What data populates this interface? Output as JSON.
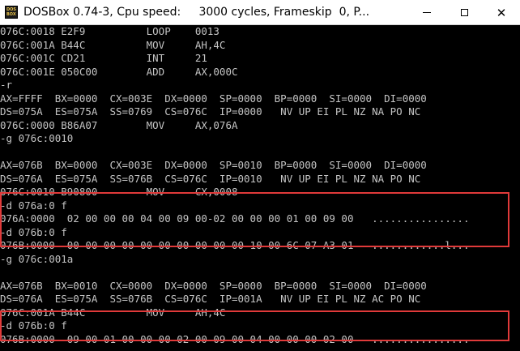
{
  "window": {
    "title": "DOSBox 0.74-3, Cpu speed:     3000 cycles, Frameskip  0, P...",
    "icon_label_top": "DOS",
    "icon_label_bottom": "BOX",
    "icon": "dosbox-icon",
    "buttons": [
      "minimize-icon",
      "maximize-icon",
      "close-icon"
    ],
    "close_glyph": "✕"
  },
  "console": {
    "lines": [
      "076C:0018 E2F9          LOOP    0013",
      "076C:001A B44C          MOV     AH,4C",
      "076C:001C CD21          INT     21",
      "076C:001E 050C00        ADD     AX,000C",
      "-r",
      "AX=FFFF  BX=0000  CX=003E  DX=0000  SP=0000  BP=0000  SI=0000  DI=0000",
      "DS=075A  ES=075A  SS=0769  CS=076C  IP=0000   NV UP EI PL NZ NA PO NC",
      "076C:0000 B86A07        MOV     AX,076A",
      "-g 076c:0010",
      "",
      "AX=076B  BX=0000  CX=003E  DX=0000  SP=0010  BP=0000  SI=0000  DI=0000",
      "DS=076A  ES=075A  SS=076B  CS=076C  IP=0010   NV UP EI PL NZ NA PO NC",
      "076C:0010 B90800        MOV     CX,0008",
      "-d 076a:0 f",
      "076A:0000  02 00 00 00 04 00 09 00-02 00 00 00 01 00 09 00   ................",
      "-d 076b:0 f",
      "076B:0000  00 00 00 00 00 00 00 00-00 00 10 00 6C 07 A3 01   ............l...",
      "-g 076c:001a",
      "",
      "AX=076B  BX=0010  CX=0000  DX=0000  SP=0000  BP=0000  SI=0000  DI=0000",
      "DS=076A  ES=075A  SS=076B  CS=076C  IP=001A   NV UP EI PL NZ AC PO NC",
      "076C:001A B44C          MOV     AH,4C",
      "-d 076b:0 f",
      "076B:0000  09 00 01 00 00 00 02 00-09 00 04 00 00 00 02 00   ................"
    ]
  },
  "colors": {
    "console_text": "#c4c4c4",
    "console_bg": "#000000",
    "highlight": "#e03a3a"
  }
}
